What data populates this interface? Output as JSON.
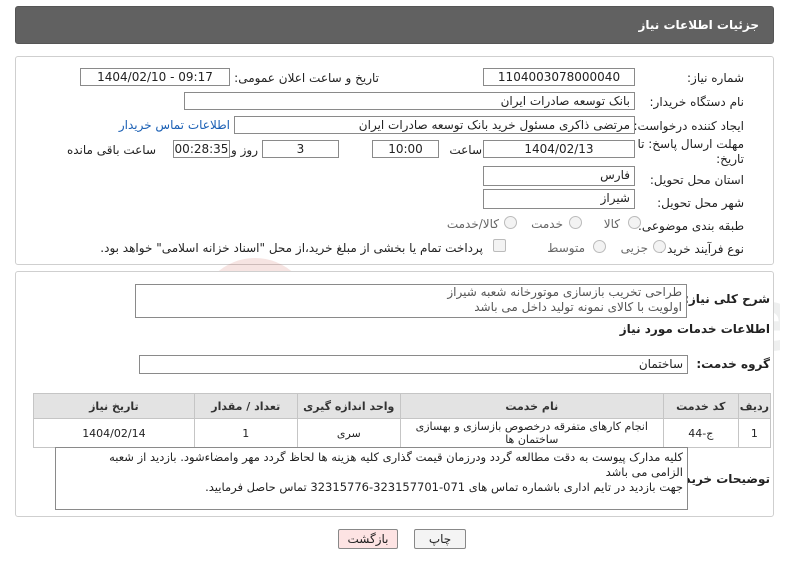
{
  "header": {
    "title": "جزئیات اطلاعات نیاز"
  },
  "fields": {
    "need_number_label": "شماره نیاز:",
    "need_number": "1104003078000040",
    "announce_label": "تاریخ و ساعت اعلان عمومی:",
    "announce_value": "1404/02/10 - 09:17",
    "buyer_org_label": "نام دستگاه خریدار:",
    "buyer_org": "بانک توسعه صادرات ایران",
    "requester_label": "ایجاد کننده درخواست:",
    "requester": "مرتضی ذاکری مسئول خرید بانک توسعه صادرات ایران",
    "contact_link": "اطلاعات تماس خریدار",
    "deadline_label_1": "مهلت ارسال پاسخ: تا",
    "deadline_label_2": "تاریخ:",
    "deadline_date": "1404/02/13",
    "hour_label": "ساعت",
    "deadline_hour": "10:00",
    "day_label": "روز و",
    "days": "3",
    "remaining_time": "00:28:35",
    "remaining_label": "ساعت باقی مانده",
    "province_label": "استان محل تحویل:",
    "province": "فارس",
    "city_label": "شهر محل تحویل:",
    "city": "شیراز",
    "category_label": "طبقه بندی موضوعی:",
    "category_options": [
      "کالا",
      "خدمت",
      "کالا/خدمت"
    ],
    "process_label": "نوع فرآیند خرید :",
    "process_options": [
      "جزیی",
      "متوسط"
    ],
    "payment_note": "پرداخت تمام یا بخشی از مبلغ خرید،از محل \"اسناد خزانه اسلامی\" خواهد بود."
  },
  "summary": {
    "label": "شرح کلی نیاز:",
    "line1": "طراحی تخریب بازسازی موتورخانه شعبه شیراز",
    "line2": "اولویت با کالای نمونه تولید داخل می باشد"
  },
  "services": {
    "section_title": "اطلاعات خدمات مورد نیاز",
    "group_label": "گروه خدمت:",
    "group_value": "ساختمان",
    "columns": [
      "ردیف",
      "کد خدمت",
      "نام خدمت",
      "واحد اندازه گیری",
      "تعداد / مقدار",
      "تاریخ نیاز"
    ],
    "rows": [
      [
        "1",
        "ج-44",
        "انجام کارهای متفرقه درخصوص بازسازی و بهسازی ساختمان ها",
        "سری",
        "1",
        "1404/02/14"
      ]
    ]
  },
  "buyer_notes": {
    "label": "توضیحات خریدار:",
    "line1": "کلیه مدارک پیوست به دقت مطالعه گردد ودرزمان قیمت گذاری کلیه هزینه ها لحاظ گردد مهر وامضاءشود. بازدید از شعبه",
    "line2": "الزامی می باشد",
    "line3": "جهت بازدید در تایم اداری باشماره تماس های 071-323157701-32315776 تماس حاصل فرمایید."
  },
  "buttons": {
    "print": "چاپ",
    "back": "بازگشت"
  },
  "watermark": "AriaTender.neT",
  "colors": {
    "title_bar": "#616161",
    "link": "#1a5fb4",
    "back_button": "#fde3e3",
    "watermark": "#c0392b"
  }
}
